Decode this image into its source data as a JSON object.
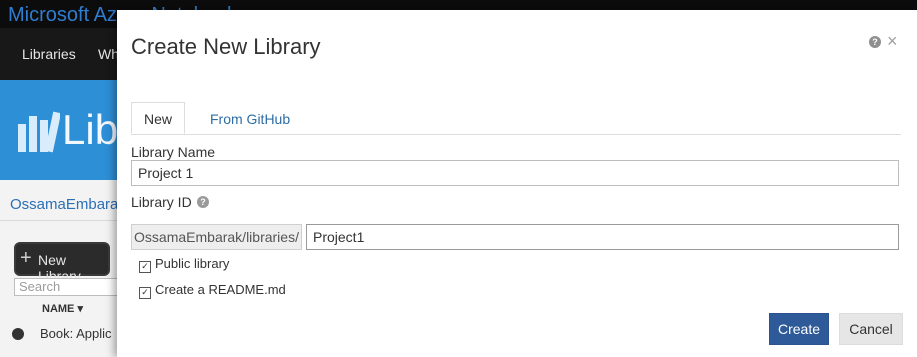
{
  "background_app": {
    "title": "Microsoft Azure Notebooks",
    "nav": [
      "Libraries",
      "Wh"
    ],
    "banner_text": "Libr",
    "username": "OssamaEmbarak",
    "new_library_label": "New Library",
    "search_placeholder": "Search",
    "name_column": "NAME ▾",
    "book_row": "Book: Applic"
  },
  "modal": {
    "title": "Create New Library",
    "help_icon": "?",
    "close_icon": "×",
    "tabs": [
      {
        "label": "New",
        "active": true
      },
      {
        "label": "From GitHub",
        "active": false
      }
    ],
    "library_name": {
      "label": "Library Name",
      "value": "Project 1"
    },
    "library_id": {
      "label": "Library ID",
      "prefix": "OssamaEmbarak/libraries/",
      "value": "Project1",
      "info_icon": "?"
    },
    "options": [
      {
        "label": "Public library",
        "checked": true
      },
      {
        "label": "Create a README.md",
        "checked": true
      }
    ],
    "buttons": {
      "create": "Create",
      "cancel": "Cancel"
    }
  },
  "colors": {
    "accent_blue": "#2e5a99",
    "banner_blue": "#2d8fd6",
    "link_blue": "#2e6da4"
  }
}
